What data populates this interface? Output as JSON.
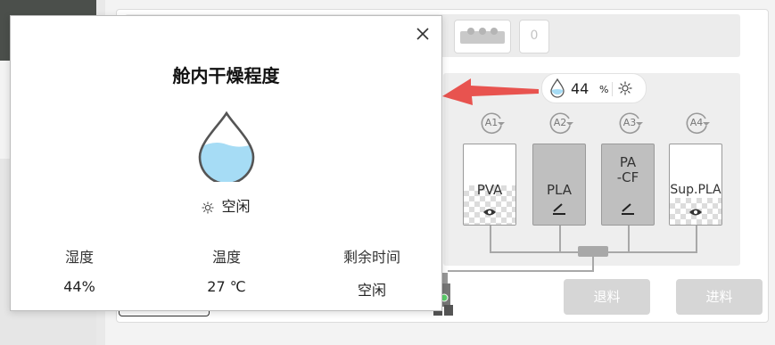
{
  "dialog": {
    "title": "舱内干燥程度",
    "status": "空闲",
    "stats": [
      {
        "label": "湿度",
        "value": "44%"
      },
      {
        "label": "温度",
        "value": "27 ℃"
      },
      {
        "label": "剩余时间",
        "value": "空闲"
      }
    ]
  },
  "ams": {
    "humidity_value": "44",
    "humidity_unit": "%",
    "top_slot_label": "0",
    "slots": [
      {
        "tag": "A1",
        "material": "PVA",
        "action_icon": "eye-icon"
      },
      {
        "tag": "A2",
        "material": "PLA",
        "action_icon": "edit-icon"
      },
      {
        "tag": "A3",
        "material": "PA\n-CF",
        "action_icon": "edit-icon"
      },
      {
        "tag": "A4",
        "material": "Sup.PLA",
        "action_icon": "eye-icon"
      }
    ]
  },
  "buttons": {
    "unload": "退料",
    "load": "进料"
  },
  "colors": {
    "accent_red": "#e8534f",
    "drop_blue": "#a6dcf5",
    "button_grey": "#d6d6d6"
  }
}
